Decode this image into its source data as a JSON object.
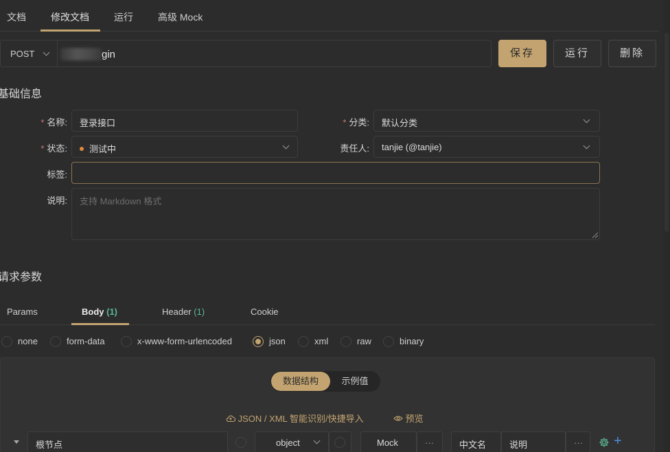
{
  "top_tabs": [
    {
      "label": "文档"
    },
    {
      "label": "修改文档"
    },
    {
      "label": "运行"
    },
    {
      "label": "高级 Mock"
    }
  ],
  "request": {
    "method": "POST",
    "url_visible": "gin"
  },
  "actions": {
    "save": "保存",
    "run": "运行",
    "delete": "删除"
  },
  "basic_info": {
    "title": "基础信息",
    "name_label": "名称:",
    "name_value": "登录接口",
    "category_label": "分类:",
    "category_value": "默认分类",
    "status_label": "状态:",
    "status_value": "测试中",
    "owner_label": "责任人:",
    "owner_value": "tanjie (@tanjie)",
    "tags_label": "标签:",
    "desc_label": "说明:",
    "desc_placeholder": "支持 Markdown 格式",
    "required_mark": "*"
  },
  "params": {
    "title": "请求参数",
    "tabs": [
      {
        "label": "Params",
        "count": ""
      },
      {
        "label": "Body",
        "count": "(1)"
      },
      {
        "label": "Header",
        "count": "(1)"
      },
      {
        "label": "Cookie",
        "count": ""
      }
    ],
    "body_types": [
      "none",
      "form-data",
      "x-www-form-urlencoded",
      "json",
      "xml",
      "raw",
      "binary"
    ],
    "body_type_selected": "json"
  },
  "editor": {
    "seg_active": "数据结构",
    "seg_other": "示例值",
    "import_link": "JSON / XML 智能识别/快捷导入",
    "preview_link": "预览",
    "root_placeholder": "根节点",
    "type_value": "object",
    "mock_placeholder": "Mock",
    "more": "···",
    "cn_name_placeholder": "中文名",
    "desc_placeholder": "说明",
    "add": "+"
  },
  "colors": {
    "accent": "#c3a470",
    "background": "#2c2c2c",
    "count_green": "#5cb894",
    "status_orange": "#e08a3c"
  }
}
